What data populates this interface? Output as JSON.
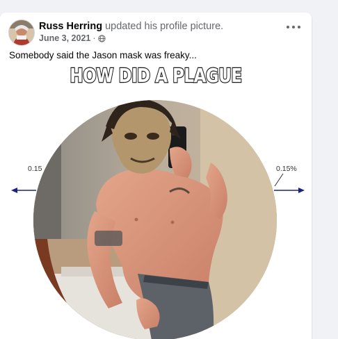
{
  "post": {
    "author": "Russ Herring",
    "action": "updated his profile picture.",
    "date": "June 3, 2021",
    "separator": "·",
    "audience_icon": "globe-icon",
    "more_icon": "more-horizontal-icon",
    "caption": "Somebody said the Jason mask was freaky..."
  },
  "photo": {
    "meme_text": "HOW DID A PLAGUE",
    "left_value": "0.15",
    "right_value": "0.15%"
  },
  "colors": {
    "page_bg": "#f0f2f5",
    "card_bg": "#ffffff",
    "author_text": "#050505",
    "secondary_text": "#65676b",
    "arrow": "#1a237e"
  }
}
